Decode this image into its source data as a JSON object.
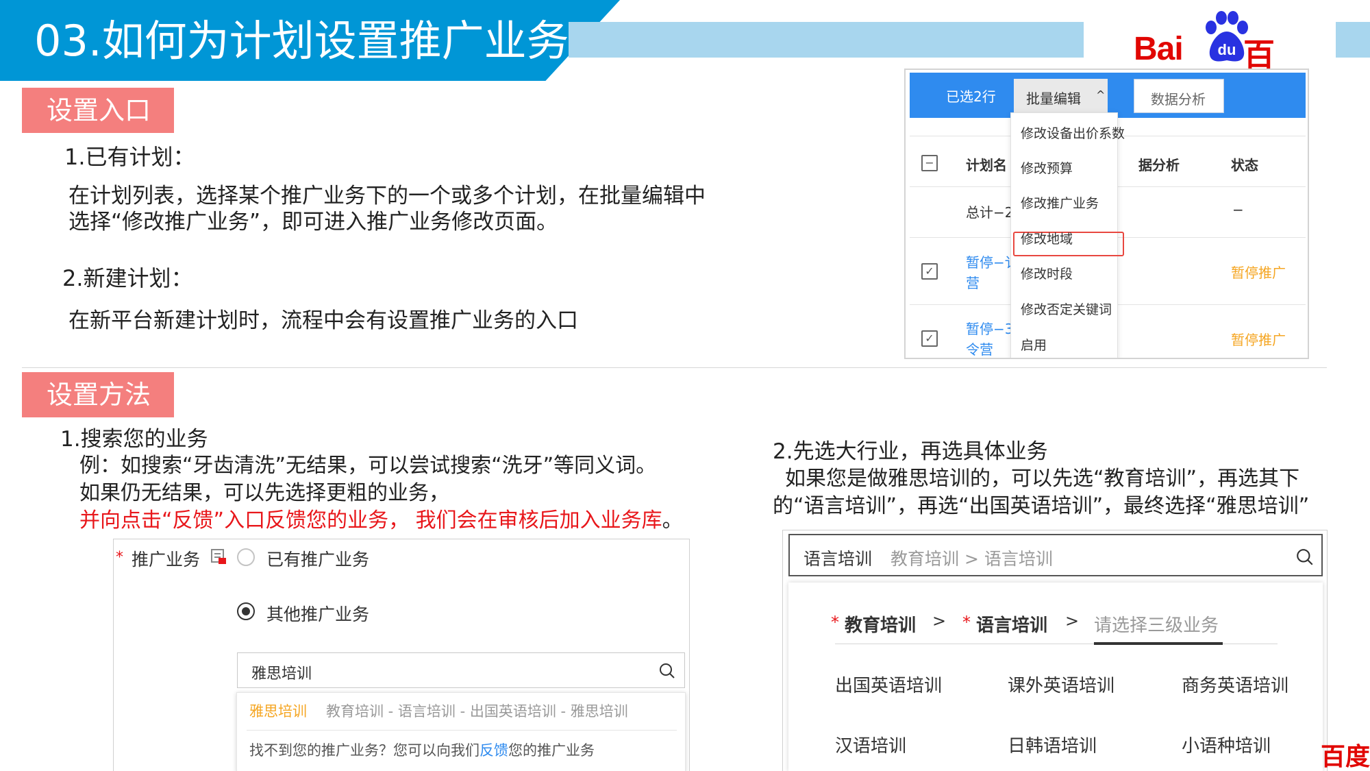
{
  "header": {
    "title": "03.如何为计划设置推广业务",
    "logo_latin": "Bai",
    "logo_paw_text": "du",
    "logo_cn": "百度"
  },
  "section1": {
    "tag": "设置入口",
    "item1_title": "1.已有计划：",
    "item1_line1": "在计划列表，选择某个推广业务下的一个或多个计划，在批量编辑中",
    "item1_line2": "选择“修改推广业务”，即可进入推广业务修改页面。",
    "item2_title": "2.新建计划：",
    "item2_line1": "在新平台新建计划时，流程中会有设置推广业务的入口"
  },
  "panel_batch": {
    "selected_label": "已选2行",
    "batch_edit_label": "批量编辑",
    "caret": "^",
    "data_analysis_label": "数据分析",
    "col_plan": "计划名",
    "col_analysis": "据分析",
    "col_status": "状态",
    "check_minus": "−",
    "check_tick": "✓",
    "row_total_name": "总计−2",
    "row_total_status": "−",
    "row1_name_line1": "暂停−讠",
    "row1_name_line2": "营",
    "row1_status": "暂停推广",
    "row2_name_line1": "暂停−3",
    "row2_name_line2": "令营",
    "row2_status": "暂停推广",
    "menu": [
      "修改设备出价系数",
      "修改预算",
      "修改推广业务",
      "修改地域",
      "修改时段",
      "修改否定关键词",
      "启用"
    ]
  },
  "section2": {
    "tag": "设置方法",
    "m1_title": "1.搜索您的业务",
    "m1_line1": "例：如搜索“牙齿清洗”无结果，可以尝试搜索“洗牙”等同义词。",
    "m1_line2": "如果仍无结果，可以先选择更粗的业务，",
    "m1_line3_red": "并向点击“反馈”入口反馈您的业务， 我们会在审核后加入业务库",
    "m1_line3_end": "。",
    "m2_title": "2.先选大行业，再选具体业务",
    "m2_line1": "如果您是做雅思培训的，可以先选“教育培训”，再选其下",
    "m2_line2": "的“语言培训”，再选“出国英语培训”，最终选择“雅思培训”"
  },
  "panel_search": {
    "required_star": "*",
    "field_label": "推广业务",
    "option_existing": "已有推广业务",
    "option_other": "其他推广业务",
    "search_value": "雅思培训",
    "result_name": "雅思培训",
    "result_path": "教育培训 - 语言培训 - 出国英语培训 - 雅思培训",
    "not_found_prefix": "找不到您的推广业务？您可以向我们",
    "feedback_link": "反馈",
    "not_found_suffix": "您的推广业务"
  },
  "panel_category": {
    "search_value": "语言培训",
    "search_path": "教育培训 > 语言培训",
    "required_star": "*",
    "level1": "教育培训",
    "level2": "语言培训",
    "separator": ">",
    "level3_placeholder": "请选择三级业务",
    "options": [
      "出国英语培训",
      "课外英语培训",
      "商务英语培训",
      "汉语培训",
      "日韩语培训",
      "小语种培训"
    ]
  },
  "footer": {
    "corner_logo": "百度"
  },
  "colors": {
    "title_blue": "#0096d6",
    "strip_blue": "#a8d6ee",
    "tag_pink": "#f47f7e",
    "baidu_red": "#e10602",
    "accent_red": "#e8161a",
    "link_blue": "#2f8bef",
    "status_orange": "#f5a623",
    "result_orange": "#f5a623"
  }
}
